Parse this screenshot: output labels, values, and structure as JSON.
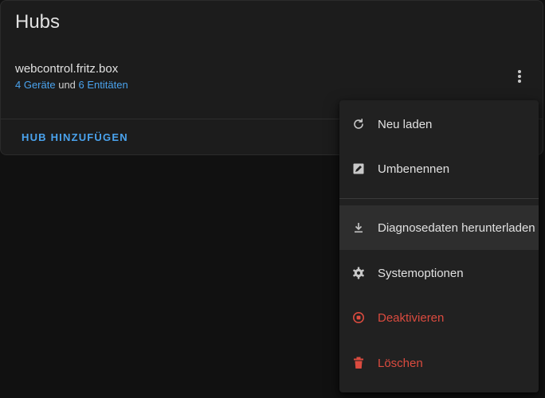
{
  "card": {
    "title": "Hubs",
    "hub_name": "webcontrol.fritz.box",
    "devices_link": "4 Geräte",
    "connector": "und",
    "entities_link": "6 Entitäten",
    "add_hub_label": "HUB HINZUFÜGEN"
  },
  "menu": {
    "items": [
      {
        "label": "Neu laden",
        "icon": "reload-icon"
      },
      {
        "label": "Umbenennen",
        "icon": "rename-icon"
      },
      {
        "label": "Diagnosedaten herunterladen",
        "icon": "download-icon"
      },
      {
        "label": "Systemoptionen",
        "icon": "gear-icon"
      },
      {
        "label": "Deaktivieren",
        "icon": "stop-circle-icon"
      },
      {
        "label": "Löschen",
        "icon": "trash-icon"
      }
    ]
  },
  "colors": {
    "background": "#111111",
    "card": "#1c1c1c",
    "menu": "#212121",
    "accent": "#4aa3ee",
    "danger": "#db4b3f",
    "text": "#e1e1e1"
  }
}
